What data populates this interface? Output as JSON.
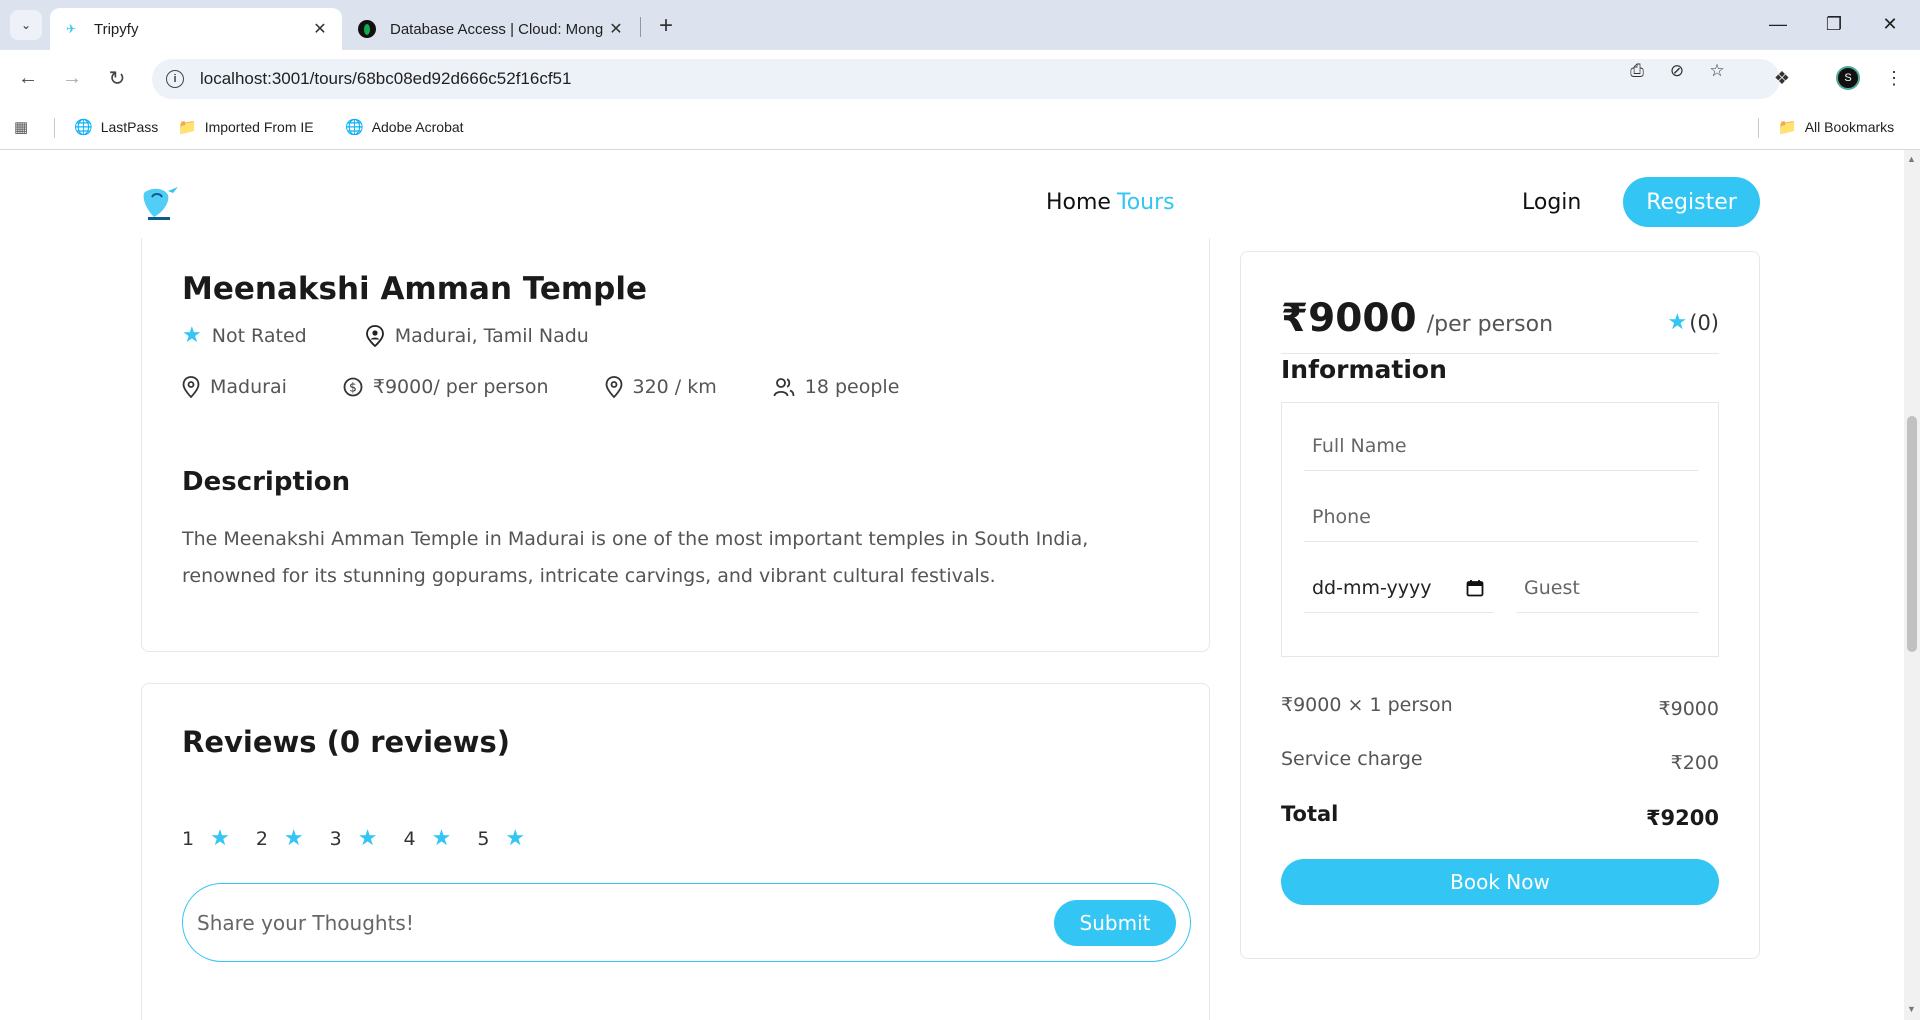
{
  "browser": {
    "tabs": [
      {
        "title": "Tripyfy",
        "active": true
      },
      {
        "title": "Database Access | Cloud: Mong",
        "active": false
      }
    ],
    "url": "localhost:3001/tours/68bc08ed92d666c52f16cf51",
    "bookmarks": [
      "LastPass",
      "Imported From IE",
      "Adobe Acrobat"
    ],
    "all_bookmarks": "All Bookmarks",
    "profile_initial": "S"
  },
  "header": {
    "nav": {
      "home": "Home",
      "tours": "Tours"
    },
    "login": "Login",
    "register": "Register"
  },
  "tour": {
    "title": "Meenakshi Amman Temple",
    "rating": "Not Rated",
    "address": "Madurai, Tamil Nadu",
    "city": "Madurai",
    "price_per_person": "₹9000/ per person",
    "distance": "320 / km",
    "max_group": "18 people",
    "description_title": "Description",
    "description": "The Meenakshi Amman Temple in Madurai is one of the most important temples in South India, renowned for its stunning gopurams, intricate carvings, and vibrant cultural festivals."
  },
  "reviews": {
    "title": "Reviews (0 reviews)",
    "rating_options": [
      "1",
      "2",
      "3",
      "4",
      "5"
    ],
    "placeholder": "Share your Thoughts!",
    "submit": "Submit"
  },
  "booking": {
    "price": "₹9000",
    "unit": "/per person",
    "rating_count": "(0)",
    "info_title": "Information",
    "full_name_placeholder": "Full Name",
    "phone_placeholder": "Phone",
    "date_placeholder": "dd-mm-yyyy",
    "guest_placeholder": "Guest",
    "line_item_label": "₹9000 × 1 person",
    "line_item_value": "₹9000",
    "service_label": "Service charge",
    "service_value": "₹200",
    "total_label": "Total",
    "total_value": "₹9200",
    "book_now": "Book Now"
  },
  "colors": {
    "accent": "#33c5f3"
  }
}
